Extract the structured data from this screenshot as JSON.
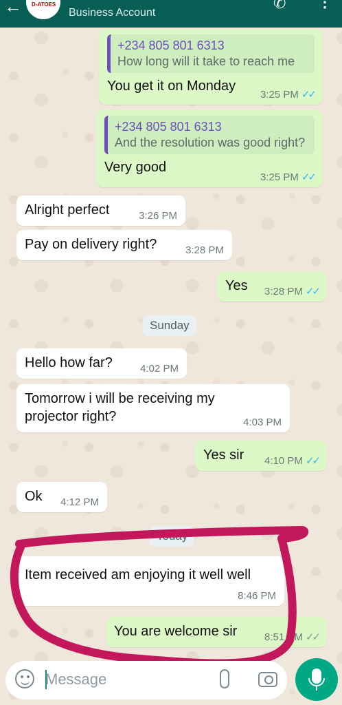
{
  "header": {
    "avatar_text": "D-ATOES",
    "subtitle": "Business Account"
  },
  "messages": [
    {
      "quote_author": "+234 805 801 6313",
      "quote_text": "How long will it take to reach me",
      "text": "You get it on Monday",
      "time": "3:25 PM"
    },
    {
      "quote_author": "+234 805 801 6313",
      "quote_text": "And the resolution was good right?",
      "text": "Very good",
      "time": "3:25 PM"
    },
    {
      "text": "Alright perfect",
      "time": "3:26 PM"
    },
    {
      "text": "Pay on delivery right?",
      "time": "3:28 PM"
    },
    {
      "text": "Yes",
      "time": "3:28 PM"
    },
    {
      "text": "Hello how far?",
      "time": "4:02 PM"
    },
    {
      "text": "Tomorrow i will be receiving my projector right?",
      "time": "4:03 PM"
    },
    {
      "text": "Yes sir",
      "time": "4:10 PM"
    },
    {
      "text": "Ok",
      "time": "4:12 PM"
    },
    {
      "text": "Item received am enjoying it well well",
      "time": "8:46 PM"
    },
    {
      "text": "You are welcome sir",
      "time": "8:51 PM"
    }
  ],
  "date_chips": {
    "sunday": "Sunday",
    "today": "Today"
  },
  "input": {
    "placeholder": "Message"
  },
  "colors": {
    "header": "#075e54",
    "outgoing": "#dcf8c6",
    "incoming": "#ffffff",
    "tick": "#34b7f1",
    "mic": "#00a884",
    "annotation": "#c2185b"
  }
}
